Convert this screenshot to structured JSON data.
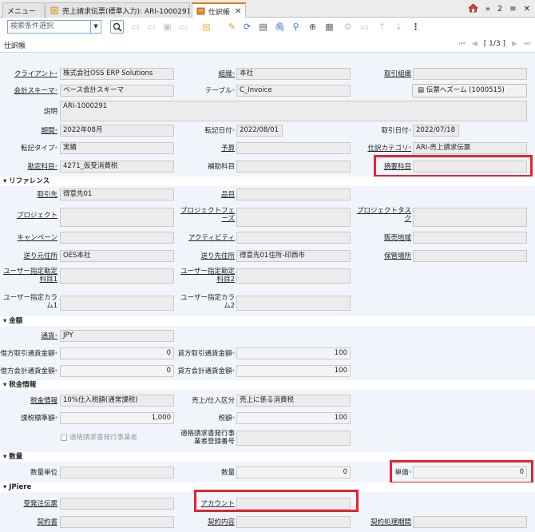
{
  "tabs": [
    {
      "label": "メニュー"
    },
    {
      "label": "売上請求伝票(標準入力): ARI-1000291"
    },
    {
      "label": "仕訳帳"
    }
  ],
  "tabbar": {
    "badge": "2"
  },
  "search": {
    "placeholder": "検索条件選択"
  },
  "navbar": {
    "title": "仕訳帳",
    "page": "[ 1/3 ]"
  },
  "sections": {
    "reference": "リファレンス",
    "amount": "金額",
    "tax": "税金情報",
    "quantity": "数量",
    "jpiere": "JPiere"
  },
  "labels": {
    "client": "クライアント",
    "org": "組織",
    "trx_org": "取引組織",
    "schema": "会計スキーマ",
    "table": "テーブル",
    "desc": "説明",
    "period": "期間",
    "post_date": "転記日付",
    "trx_date": "取引日付",
    "post_type": "転記タイプ",
    "budget": "予算",
    "post_cat": "仕訳カテゴリ",
    "account": "勘定科目",
    "sub_account": "補助科目",
    "summary_account": "摘要科目",
    "bpartner": "取引先",
    "product": "品目",
    "project": "プロジェクト",
    "project_phase": "プロジェクトフェーズ",
    "project_task": "プロジェクトタスク",
    "campaign": "キャンペーン",
    "activity": "アクティビティ",
    "sales_region": "販売地域",
    "ship_from": "送り元住所",
    "ship_to": "送り先住所",
    "locator": "保管場所",
    "user1": "ユーザー指定勘定科目1",
    "user2": "ユーザー指定勘定科目2",
    "ucol1": "ユーザー指定カラム1",
    "ucol2": "ユーザー指定カラム2",
    "currency": "通貨",
    "dr_src": "借方取引通貨金額",
    "cr_src": "貸方取引通貨金額",
    "dr_acct": "借方会計通貨金額",
    "cr_acct": "貸方会計通貨金額",
    "tax_info": "税金情報",
    "sales_purchase": "売上/仕入区分",
    "tax_base": "課税標準額",
    "tax_amt": "税額",
    "qualified_issuer": "適格請求書発行事業者",
    "qualified_reg": "適格請求書発行事業者登録番号",
    "uom": "数量単位",
    "qty": "数量",
    "unit_price": "単価",
    "order_doc": "受発注伝票",
    "jp_account": "アカウント",
    "contract": "契約書",
    "contract_content": "契約内容",
    "contract_period": "契約処理期間"
  },
  "values": {
    "client": "株式会社OSS ERP Solutions",
    "org": "本社",
    "schema": "ベース会計スキーマ",
    "table": "C_Invoice",
    "doc_button": "伝票へズーム (1000515)",
    "desc": "ARI-1000291",
    "period": "2022年08月",
    "post_date": "2022/08/01",
    "trx_date": "2022/07/18",
    "post_type": "実績",
    "post_cat": "ARI-売上請求伝票",
    "account": "4271_仮受消費税",
    "bpartner": "得意先01",
    "ship_from": "OES本社",
    "ship_to": "得意先01住所-印西市",
    "currency": "JPY",
    "dr_src": "0",
    "cr_src": "100",
    "dr_acct": "0",
    "cr_acct": "100",
    "tax_info": "10%仕入税額(通常課税)",
    "sales_purchase": "売上に係る消費税",
    "tax_base": "1,000",
    "tax_amt": "100",
    "qty": "0",
    "unit_price": "0"
  }
}
